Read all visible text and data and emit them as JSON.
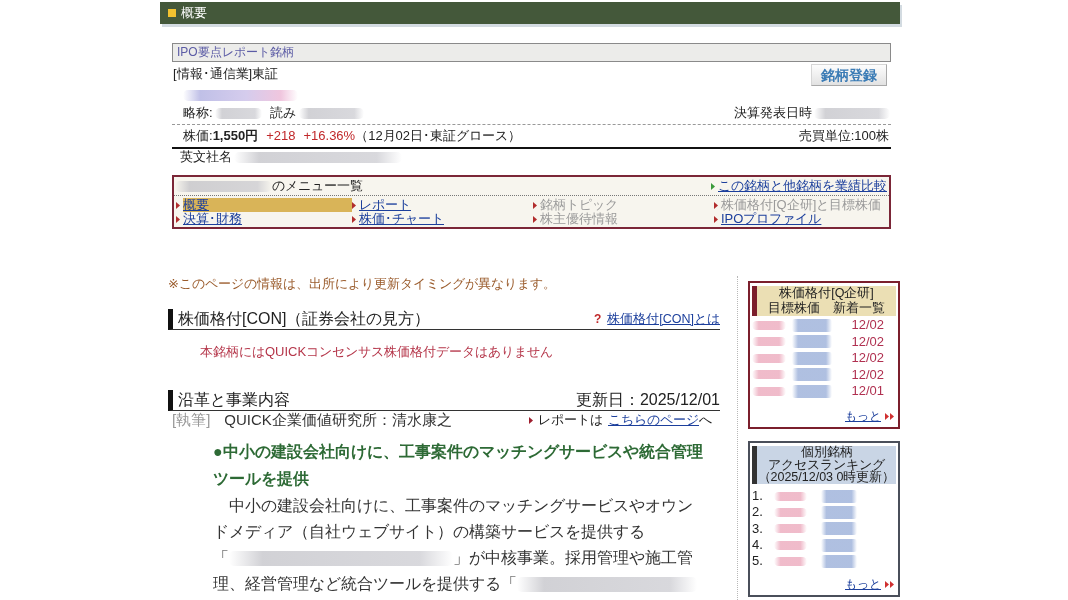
{
  "header": {
    "title": "概要"
  },
  "stock_info": {
    "badge": "IPO要点レポート銘柄",
    "category": "[情報･通信業]東証",
    "register_button": "銘柄登録",
    "company_name": {
      "redacted": true
    },
    "abbreviation": {
      "label": "略称:",
      "redacted": true
    },
    "reading": {
      "label": "読み",
      "redacted": true
    },
    "earnings_date": {
      "label": "決算発表日時",
      "redacted": true
    },
    "price": {
      "label": "株価:",
      "value": "1,550円",
      "change": "+218",
      "change_pct": "+16.36%",
      "note": "（12月02日･東証グロース）"
    },
    "trading_unit": "売買単位:100株",
    "english_name": {
      "label": "英文社名",
      "redacted": true
    }
  },
  "menu": {
    "company_redacted": true,
    "title": "のメニュー一覧",
    "compare_link": "この銘柄と他銘柄を業績比較",
    "items": [
      {
        "label": "概要",
        "selected": true,
        "disabled": false
      },
      {
        "label": "レポート",
        "selected": false,
        "disabled": false
      },
      {
        "label": "銘柄トピック",
        "selected": false,
        "disabled": true
      },
      {
        "label": "株価格付[Q企研]と目標株価",
        "selected": false,
        "disabled": true
      },
      {
        "label": "決算･財務",
        "selected": false,
        "disabled": false
      },
      {
        "label": "株価･チャート",
        "selected": false,
        "disabled": false
      },
      {
        "label": "株主優待情報",
        "selected": false,
        "disabled": true
      },
      {
        "label": "IPOプロファイル",
        "selected": false,
        "disabled": false
      }
    ]
  },
  "notice": "※このページの情報は、出所により更新タイミングが異なります。",
  "rating_section": {
    "title": "株価格付[CON]（証券会社の見方）",
    "help_mark": "?",
    "help_link": "株価格付[CON]とは",
    "message": "本銘柄にはQUICKコンセンサス株価格付データはありません"
  },
  "business_section": {
    "title": "沿革と事業内容",
    "updated": "更新日：2025/12/01",
    "author_tag": "[執筆]",
    "author": "QUICK企業価値研究所：清水康之",
    "report_prefix": "レポートは",
    "report_link": "こちらのページ",
    "report_suffix": "へ",
    "headline": "●中小の建設会社向けに、工事案件のマッチングサービスや統合管理ツールを提供",
    "body": [
      {
        "kind": "text",
        "text": "　中小の建設会社向けに、工事案件のマッチングサービスやオウンドメディア（自社ウェブサイト）の構築サービスを提供する「"
      },
      {
        "kind": "redacted"
      },
      {
        "kind": "text",
        "text": "」が中核事業。採用管理や施工管理、経営管理など統合ツールを提供する「"
      },
      {
        "kind": "redacted"
      }
    ]
  },
  "rating_list": {
    "title_lines": [
      "株価格付[Q企研]",
      "目標株価　新着一覧"
    ],
    "rows": [
      {
        "redacted": true,
        "date": "12/02"
      },
      {
        "redacted": true,
        "date": "12/02"
      },
      {
        "redacted": true,
        "date": "12/02"
      },
      {
        "redacted": true,
        "date": "12/02"
      },
      {
        "redacted": true,
        "date": "12/01"
      }
    ],
    "more_link": "もっと"
  },
  "ranking": {
    "title_lines": [
      "個別銘柄",
      "アクセスランキング",
      "（2025/12/03 0時更新）"
    ],
    "rows": [
      {
        "rank": "1.",
        "redacted": true
      },
      {
        "rank": "2.",
        "redacted": true
      },
      {
        "rank": "3.",
        "redacted": true
      },
      {
        "rank": "4.",
        "redacted": true
      },
      {
        "rank": "5.",
        "redacted": true
      }
    ],
    "more_link": "もっと"
  }
}
